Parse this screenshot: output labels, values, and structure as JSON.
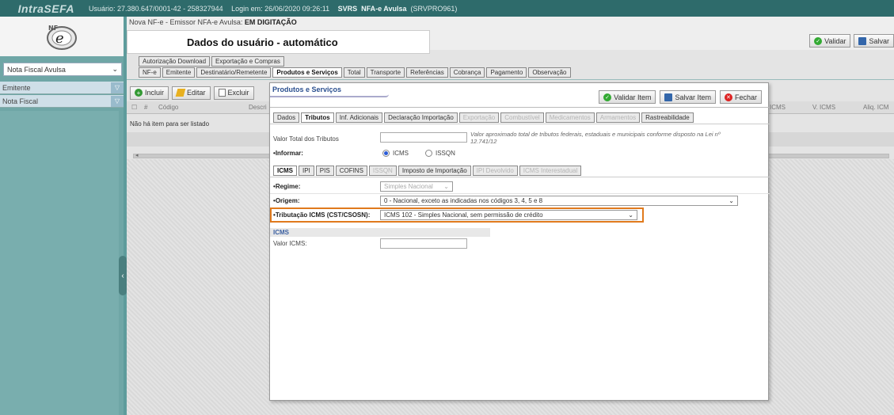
{
  "topbar": {
    "brand": "IntraSEFA",
    "usuario": "Usuário: 27.380.647/0001-42 - 258327944",
    "login": "Login em: 26/06/2020 09:26:11",
    "svrs": "SVRS",
    "app": "NFA-e Avulsa",
    "server": "(SRVPRO961)"
  },
  "sidebar": {
    "select_value": "Nota Fiscal Avulsa",
    "items": [
      {
        "label": "Emitente"
      },
      {
        "label": "Nota Fiscal"
      }
    ]
  },
  "main": {
    "title_prefix": "Nova NF-e - Emissor NFA-e Avulsa:",
    "title_status": "EM DIGITAÇÃO",
    "banner": "Dados do usuário - automático",
    "validar_label": "Validar",
    "salvar_label": "Salvar",
    "tabs_top": [
      "Autorização Download",
      "Exportação e Compras"
    ],
    "tabs_main": [
      "NF-e",
      "Emitente",
      "Destinatário/Remetente",
      "Produtos e Serviços",
      "Total",
      "Transporte",
      "Referências",
      "Cobrança",
      "Pagamento",
      "Observação"
    ],
    "active_main_tab": "Produtos e Serviços",
    "grid_buttons": {
      "incluir": "Incluir",
      "editar": "Editar",
      "excluir": "Excluir"
    },
    "grid_columns": {
      "hash": "#",
      "codigo": "Código",
      "descricao": "Descri",
      "icms": "ICMS",
      "vicms": "V. ICMS",
      "aliq": "Aliq. ICM"
    },
    "empty_message": "Não há item para ser listado"
  },
  "modal": {
    "title": "Produtos e Serviços",
    "validar_item": "Validar Item",
    "salvar_item": "Salvar Item",
    "fechar": "Fechar",
    "tabs": [
      "Dados",
      "Tributos",
      "Inf. Adicionais",
      "Declaração Importação",
      "Exportação",
      "Combustível",
      "Medicamentos",
      "Armamentos",
      "Rastreabilidade"
    ],
    "tabs_disabled": [
      "Exportação",
      "Combustível",
      "Medicamentos",
      "Armamentos"
    ],
    "active_tab": "Tributos",
    "valor_total_label": "Valor Total dos Tributos",
    "valor_total_note": "Valor aproximado total de tributos federais, estaduais e municipais conforme disposto na Lei nº 12.741/12",
    "informar_label": "Informar:",
    "informar_options": [
      "ICMS",
      "ISSQN"
    ],
    "informar_selected": "ICMS",
    "subtabs": [
      "ICMS",
      "IPI",
      "PIS",
      "COFINS",
      "ISSQN",
      "Imposto de Importação",
      "IPI Devolvido",
      "ICMS Interestadual"
    ],
    "subtabs_disabled": [
      "ISSQN",
      "IPI Devolvido",
      "ICMS Interestadual"
    ],
    "active_subtab": "ICMS",
    "regime_label": "Regime:",
    "regime_value": "Simples Nacional",
    "origem_label": "Origem:",
    "origem_value": "0 - Nacional, exceto as indicadas nos códigos 3, 4, 5 e 8",
    "tributacao_label": "Tributação ICMS (CST/CSOSN):",
    "tributacao_value": "ICMS 102 - Simples Nacional, sem permissão de crédito",
    "section_icms": "ICMS",
    "valor_icms_label": "Valor ICMS:"
  },
  "colors": {
    "highlight": "#e07a1d",
    "topbar": "#2e6b6b",
    "frame": "#5e9c9c"
  }
}
